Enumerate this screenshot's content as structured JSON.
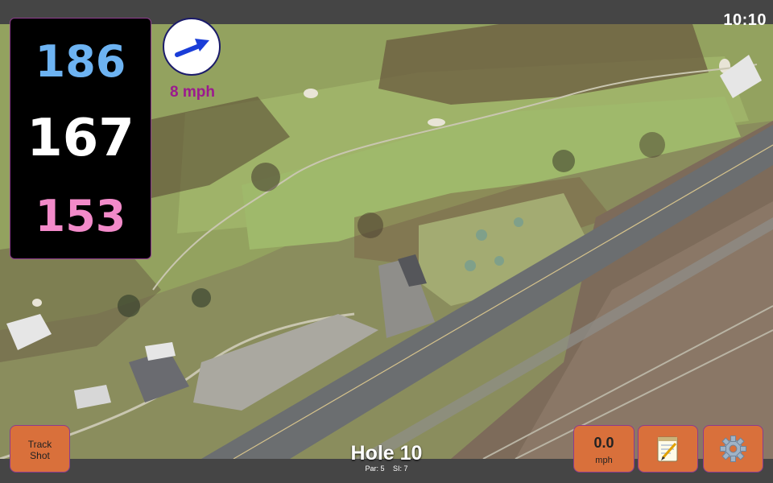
{
  "status": {
    "time": "10:10"
  },
  "distances": {
    "back": "186",
    "middle": "167",
    "front": "153"
  },
  "wind": {
    "speed_label": "8 mph",
    "icon": "wind-direction-arrow-icon"
  },
  "hole": {
    "title": "Hole 10",
    "par_label": "Par: 5",
    "si_label": "SI: 7"
  },
  "buttons": {
    "track_shot_line1": "Track",
    "track_shot_line2": "Shot",
    "speed_value": "0.0",
    "speed_unit": "mph",
    "notes_icon": "notepad-icon",
    "settings_icon": "gear-icon"
  },
  "colors": {
    "button_orange": "#d9703b",
    "back_blue": "#6db3f2",
    "front_pink": "#f28ac9",
    "wind_purple": "#9b1a8e",
    "arrow_blue": "#1a3dd8"
  }
}
